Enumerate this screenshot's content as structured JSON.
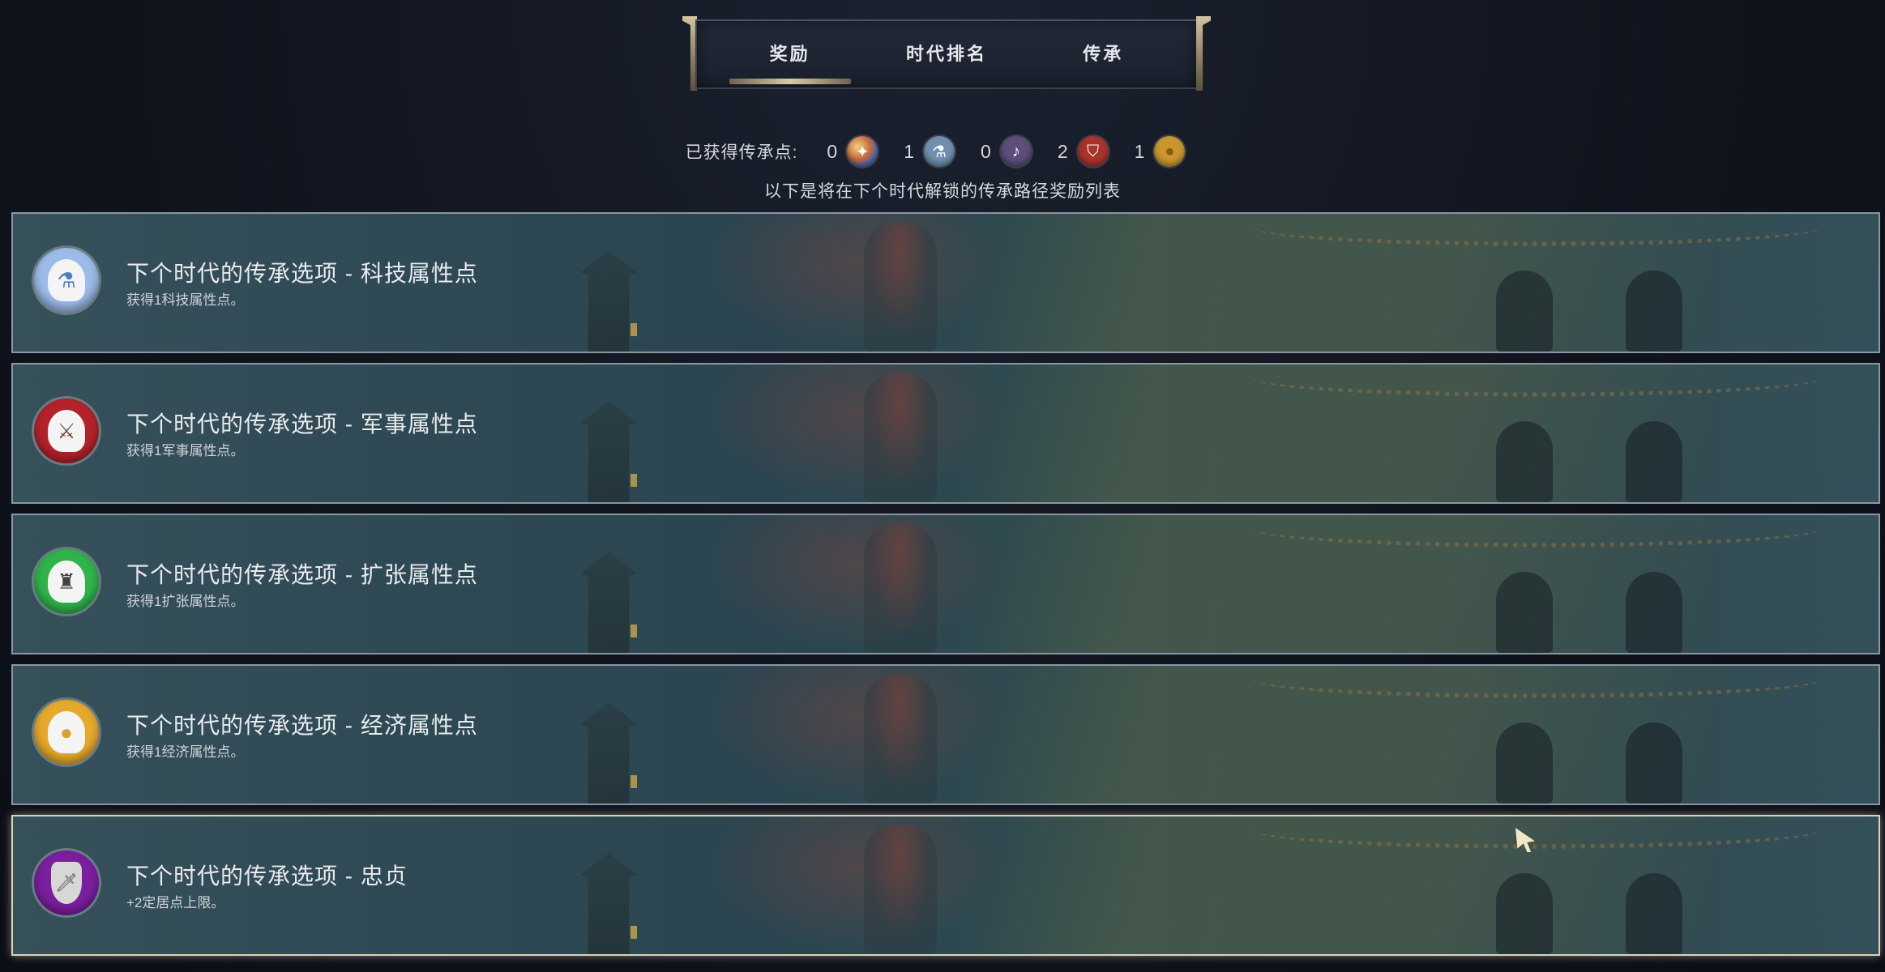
{
  "tabs": [
    {
      "label": "奖励",
      "active": true
    },
    {
      "label": "时代排名",
      "active": false
    },
    {
      "label": "传承",
      "active": false
    }
  ],
  "points": {
    "label": "已获得传承点:",
    "items": [
      {
        "count": "0",
        "icon": "multicolor-gem-icon",
        "color": "#c9a060",
        "glyph": "✦"
      },
      {
        "count": "1",
        "icon": "science-flask-icon",
        "color": "#8fb4d6",
        "glyph": "⚗"
      },
      {
        "count": "0",
        "icon": "music-note-icon",
        "color": "#6b5a8c",
        "glyph": "♪"
      },
      {
        "count": "2",
        "icon": "military-shield-icon",
        "color": "#a8332c",
        "glyph": "⛉"
      },
      {
        "count": "1",
        "icon": "gold-coin-icon",
        "color": "#d4a23a",
        "glyph": "●"
      }
    ]
  },
  "subtitle": "以下是将在下个时代解锁的传承路径奖励列表",
  "rows": [
    {
      "title": "下个时代的传承选项 - 科技属性点",
      "desc": "获得1科技属性点。",
      "icon": "science-head-icon",
      "color": "#9dbbe8",
      "glyph": "⚗",
      "glyph_color": "#4d7fc4"
    },
    {
      "title": "下个时代的传承选项 - 军事属性点",
      "desc": "获得1军事属性点。",
      "icon": "military-head-icon",
      "color": "#b3222a",
      "glyph": "⚔",
      "glyph_color": "#6d4a3a"
    },
    {
      "title": "下个时代的传承选项 - 扩张属性点",
      "desc": "获得1扩张属性点。",
      "icon": "expansion-head-icon",
      "color": "#2fb34a",
      "glyph": "♜",
      "glyph_color": "#444"
    },
    {
      "title": "下个时代的传承选项 - 经济属性点",
      "desc": "获得1经济属性点。",
      "icon": "economy-head-icon",
      "color": "#e6a92c",
      "glyph": "●",
      "glyph_color": "#d9a12e"
    },
    {
      "title": "下个时代的传承选项 - 忠贞",
      "desc": "+2定居点上限。",
      "icon": "loyalty-sword-icon",
      "color": "#7a1f9e",
      "glyph": "🗡",
      "glyph_color": "#555"
    }
  ]
}
